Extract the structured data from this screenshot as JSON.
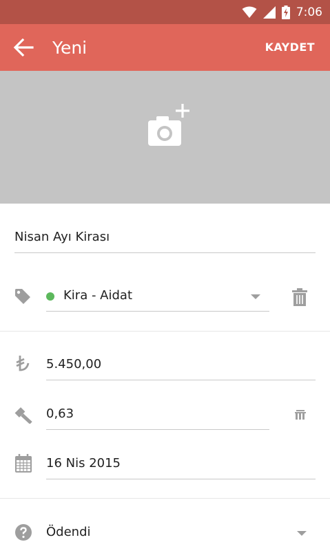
{
  "status_bar": {
    "time": "7:06"
  },
  "app_bar": {
    "title": "Yeni",
    "save_label": "KAYDET"
  },
  "form": {
    "title_value": "Nisan Ayı Kirası",
    "category": {
      "label": "Kira - Aidat",
      "dot_color": "#5cb85c"
    },
    "amount": "5.450,00",
    "rate": "0,63",
    "date": "16 Nis 2015",
    "status": "Ödendi"
  },
  "colors": {
    "accent": "#e0665a",
    "status_bar": "#b35247",
    "photo_bg": "#c4c4c4",
    "icon_gray": "#9e9e9e"
  }
}
